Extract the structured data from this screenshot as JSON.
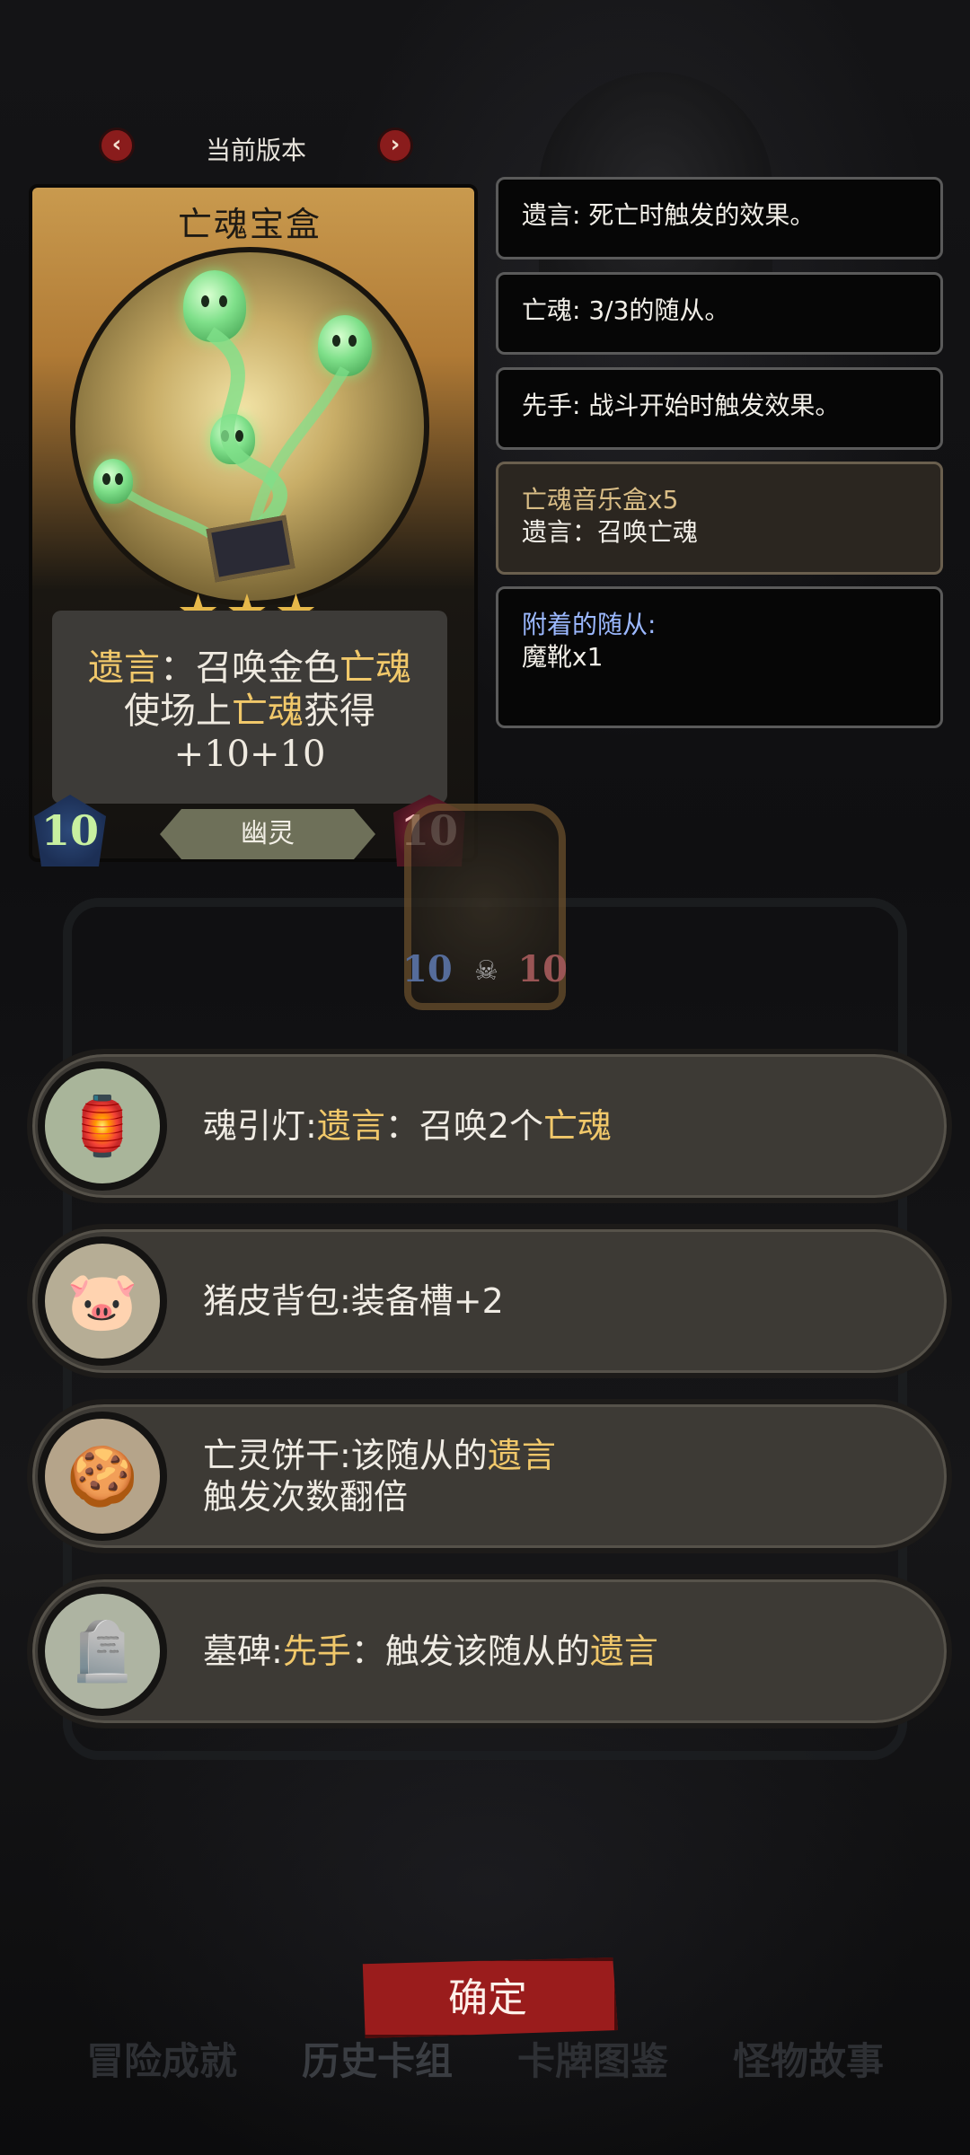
{
  "version": {
    "prev_icon": "chevron-left-icon",
    "next_icon": "chevron-right-icon",
    "label": "当前版本"
  },
  "card": {
    "title": "亡魂宝盒",
    "stars": "★★★",
    "desc_line1_a": "遗言",
    "desc_line1_b": "：召唤金色",
    "desc_line1_c": "亡魂",
    "desc_line2_a": "使场上",
    "desc_line2_b": "亡魂",
    "desc_line2_c": "获得",
    "desc_line3": "+10+10",
    "attack": "10",
    "health": "10",
    "tribe": "幽灵"
  },
  "mini_card": {
    "attack": "10",
    "health": "10"
  },
  "keywords": [
    {
      "text": "遗言: 死亡时触发的效果。"
    },
    {
      "text": "亡魂: 3/3的随从。"
    },
    {
      "text": "先手: 战斗开始时触发效果。"
    },
    {
      "title": "亡魂音乐盒x5",
      "text": "遗言：召唤亡魂"
    },
    {
      "title": "附着的随从:",
      "text": "魔靴x1"
    }
  ],
  "equipment": [
    {
      "icon": "lantern-icon",
      "name": "魂引灯:",
      "a": "遗言",
      "b": "：召唤2个",
      "c": "亡魂"
    },
    {
      "icon": "pig-backpack-icon",
      "text": "猪皮背包:装备槽+2"
    },
    {
      "icon": "skull-cookie-icon",
      "name": "亡灵饼干:该随从的",
      "a": "遗言",
      "line2": "触发次数翻倍"
    },
    {
      "icon": "tombstone-icon",
      "name": "墓碑:",
      "a": "先手",
      "b": "：触发该随从的",
      "c": "遗言"
    }
  ],
  "confirm_label": "确定",
  "bottom_tabs": [
    "冒险成就",
    "历史卡组",
    "卡牌图鉴",
    "怪物故事"
  ],
  "colors": {
    "accent_gold": "#f1c86a",
    "confirm_red": "#9a1c1c"
  }
}
